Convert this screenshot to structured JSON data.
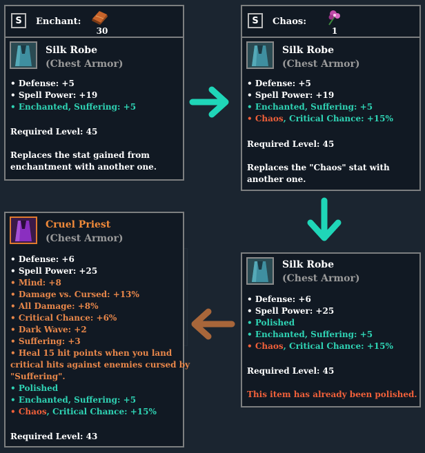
{
  "colors": {
    "background": "#1b2530",
    "panel": "#111923",
    "border": "#7d7f80",
    "stat_cyan": "#2fd3b4",
    "stat_orange": "#e8874a",
    "warning_red": "#f0603a",
    "arrow_teal": "#1fd6b8",
    "arrow_brown": "#a8663a"
  },
  "panel1": {
    "key": "S",
    "label": "Enchant:",
    "resource_icon": "enchant-stone-icon",
    "count": "30",
    "item_icon": "robe-icon",
    "title": "Silk Robe",
    "subtitle": "(Chest Armor)",
    "stats": [
      {
        "text": "• Defense: +5",
        "color": "white"
      },
      {
        "text": "• Spell Power: +19",
        "color": "white"
      },
      {
        "text": "• Enchanted, Suffering: +5",
        "color": "cyan"
      }
    ],
    "required_level": "Required Level: 45",
    "description": "Replaces the stat gained from enchantment with another one."
  },
  "panel2": {
    "key": "S",
    "label": "Chaos:",
    "resource_icon": "chaos-flower-icon",
    "count": "1",
    "item_icon": "robe-icon",
    "title": "Silk Robe",
    "subtitle": "(Chest Armor)",
    "stats": [
      {
        "text": "• Defense: +5",
        "color": "white"
      },
      {
        "text": "• Spell Power: +19",
        "color": "white"
      },
      {
        "text": "• Enchanted, Suffering: +5",
        "color": "cyan"
      }
    ],
    "chaos_line": {
      "prefix": "• Chaos",
      "rest": ", Critical Chance: +15%"
    },
    "required_level": "Required Level: 45",
    "description": "Replaces the \"Chaos\" stat with another one."
  },
  "panel3": {
    "item_icon": "robe-icon",
    "title": "Silk Robe",
    "subtitle": "(Chest Armor)",
    "stats": [
      {
        "text": "• Defense: +6",
        "color": "white"
      },
      {
        "text": "• Spell Power: +25",
        "color": "white"
      },
      {
        "text": "• Polished",
        "color": "cyan"
      },
      {
        "text": "• Enchanted, Suffering: +5",
        "color": "cyan"
      }
    ],
    "chaos_line": {
      "prefix": "• Chaos",
      "rest": ", Critical Chance: +15%"
    },
    "required_level": "Required Level: 45",
    "warning": "This item has already been polished."
  },
  "panel4": {
    "item_icon": "robe-icon",
    "title": "Cruel Priest",
    "subtitle": "(Chest Armor)",
    "stats": [
      {
        "text": "• Defense: +6",
        "color": "white"
      },
      {
        "text": "• Spell Power: +25",
        "color": "white"
      },
      {
        "text": "• Mind: +8",
        "color": "orange"
      },
      {
        "text": "• Damage vs. Cursed: +13%",
        "color": "orange"
      },
      {
        "text": "• All Damage: +8%",
        "color": "orange"
      },
      {
        "text": "• Critical Chance: +6%",
        "color": "orange"
      },
      {
        "text": "• Dark Wave: +2",
        "color": "orange"
      },
      {
        "text": "• Suffering: +3",
        "color": "orange"
      },
      {
        "text": "• Heal 15 hit points when you land",
        "color": "orange"
      },
      {
        "text": "critical hits against enemies cursed by",
        "color": "orange"
      },
      {
        "text": "\"Suffering\".",
        "color": "orange"
      },
      {
        "text": "• Polished",
        "color": "cyan"
      },
      {
        "text": "• Enchanted, Suffering: +5",
        "color": "cyan"
      }
    ],
    "chaos_line": {
      "prefix": "• Chaos",
      "rest": ", Critical Chance: +15%"
    },
    "required_level": "Required Level: 43"
  },
  "arrows": {
    "a1": "arrow-right-icon",
    "a2": "arrow-down-icon",
    "a3": "arrow-left-icon"
  }
}
